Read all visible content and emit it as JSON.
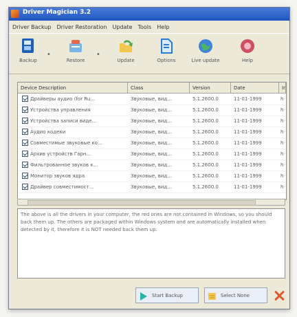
{
  "window": {
    "title": "Driver Magician 3.2"
  },
  "menu": [
    "Driver Backup",
    "Driver Restoration",
    "Update",
    "Tools",
    "Help"
  ],
  "toolbar": [
    {
      "label": "Backup",
      "icon": "backup-icon"
    },
    {
      "label": "Restore",
      "icon": "restore-icon"
    },
    {
      "label": "Update",
      "icon": "update-icon"
    },
    {
      "label": "Options",
      "icon": "options-icon"
    },
    {
      "label": "Live update",
      "icon": "live-update-icon"
    },
    {
      "label": "Help",
      "icon": "help-icon"
    }
  ],
  "table": {
    "columns": [
      "Device Description",
      "Class",
      "Version",
      "Date",
      "In"
    ],
    "rows": [
      [
        "Драйверы аудио (for Ru...",
        "Звуковые, вид...",
        "5.1.2600.0",
        "11-01-1999",
        "h"
      ],
      [
        "Устройства управления",
        "Звуковые, вид...",
        "5.1.2600.0",
        "11-01-1999",
        "h"
      ],
      [
        "Устройства записи виде...",
        "Звуковые, вид...",
        "5.1.2600.0",
        "11-01-1999",
        "h"
      ],
      [
        "Аудио кодеки",
        "Звуковые, вид...",
        "5.1.2600.0",
        "11-01-1999",
        "h"
      ],
      [
        "Совместимые звуковые ко...",
        "Звуковые, вид...",
        "5.1.2600.0",
        "11-01-1999",
        "h"
      ],
      [
        "Архив устройств Гарн...",
        "Звуковые, вид...",
        "5.1.2600.0",
        "11-01-1999",
        "h"
      ],
      [
        "Фильтрованное звуков к...",
        "Звуковые, вид...",
        "5.1.2600.0",
        "11-01-1999",
        "h"
      ],
      [
        "Монитор звуков ядра",
        "Звуковые, вид...",
        "5.1.2600.0",
        "11-01-1999",
        "h"
      ],
      [
        "Драйвер совместимост...",
        "Звуковые, вид...",
        "5.1.2600.0",
        "11-01-1999",
        "h"
      ]
    ]
  },
  "description": "The above is all the drivers in your computer, the red ones are not contained in Windows, so you should back them up. The others are packaged within Windows system and are automatically installed when detected by it, therefore it is NOT needed back them up.",
  "buttons": {
    "start_backup": "Start Backup",
    "select_none": "Select None"
  },
  "colors": {
    "titlebar": "#1f55c2",
    "window_bg": "#ece9d8",
    "accent_orange": "#dd5a2f"
  }
}
